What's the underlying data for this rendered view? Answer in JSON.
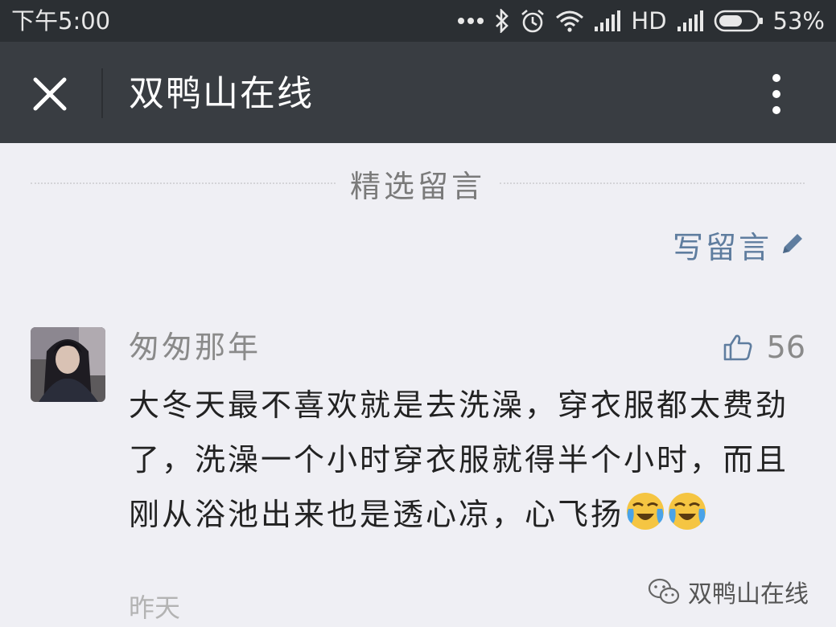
{
  "status_bar": {
    "time": "下午5:00",
    "network": "HD",
    "battery": "53%",
    "icons": [
      "more-dots-icon",
      "bluetooth-icon",
      "alarm-icon",
      "wifi-icon",
      "signal-icon",
      "signal-icon",
      "battery-icon"
    ]
  },
  "header": {
    "title": "双鸭山在线",
    "close_icon": "close-icon",
    "menu_icon": "more-vertical-icon"
  },
  "comments_section": {
    "heading": "精选留言",
    "write_label": "写留言",
    "write_icon": "pencil-icon"
  },
  "comment": {
    "username": "匆匆那年",
    "likes": "56",
    "like_icon": "thumbs-up-icon",
    "text": "大冬天最不喜欢就是去洗澡，穿衣服都太费劲了，洗澡一个小时穿衣服就得半个小时，而且刚从浴池出来也是透心凉，心飞扬",
    "emoji": [
      "crying-laughing-emoji",
      "crying-laughing-emoji"
    ],
    "date": "昨天"
  },
  "watermark": {
    "text": "双鸭山在线",
    "icon": "wechat-icon"
  },
  "colors": {
    "status_bar": "#2b2f33",
    "title_bar": "#393d42",
    "background": "#efeff4",
    "link": "#5f7d9f"
  }
}
